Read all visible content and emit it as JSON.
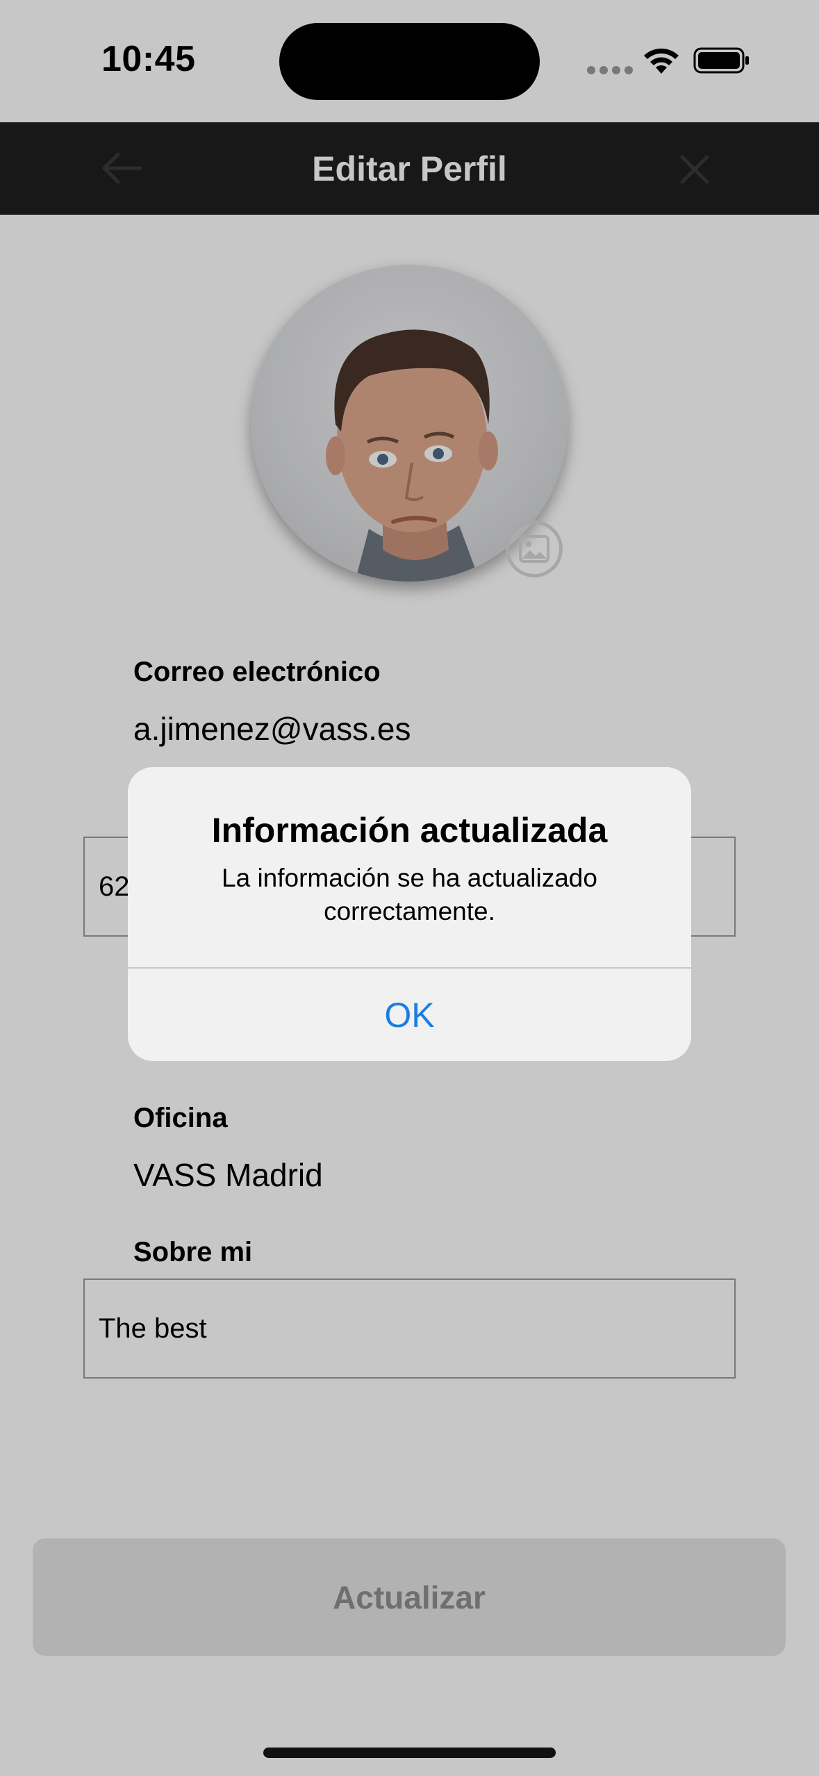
{
  "status_bar": {
    "time": "10:45"
  },
  "nav": {
    "title": "Editar Perfil"
  },
  "form": {
    "email_label": "Correo electrónico",
    "email_value": "a.jimenez@vass.es",
    "phone_value_partial": "62",
    "office_label": "Oficina",
    "office_value": "VASS Madrid",
    "about_label": "Sobre mi",
    "about_value": "The best"
  },
  "update_button": {
    "label": "Actualizar"
  },
  "alert": {
    "title": "Información actualizada",
    "message": "La información se ha actualizado correctamente.",
    "ok_label": "OK"
  },
  "colors": {
    "nav_background": "#1f1f1f",
    "alert_button": "#1a7fe0",
    "disabled_text": "#8f8f8f"
  },
  "icons": [
    "back-arrow-icon",
    "close-icon",
    "image-icon",
    "wifi-icon",
    "battery-icon"
  ]
}
